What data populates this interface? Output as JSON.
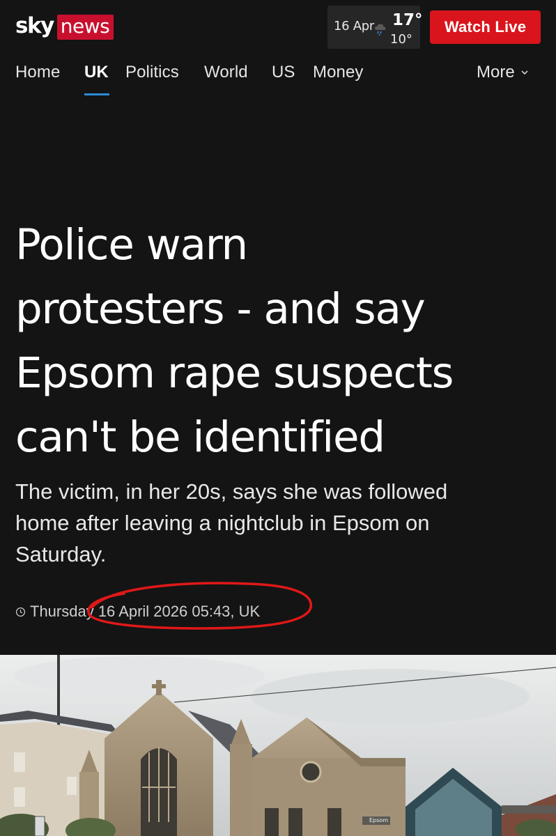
{
  "header": {
    "logo_sky": "sky",
    "logo_news": "news",
    "weather": {
      "date": "16 Apr",
      "high": "17°",
      "low": "10°",
      "icon": "cloud-rain-icon"
    },
    "watch_live": "Watch Live"
  },
  "nav": {
    "items": [
      "Home",
      "UK",
      "Politics",
      "World",
      "US",
      "Money"
    ],
    "active": "UK",
    "more": "More"
  },
  "article": {
    "headline_lines": [
      "Police warn",
      "protesters - and say",
      "Epsom rape suspects",
      "can't be identified"
    ],
    "standfirst_lines": [
      "The victim, in her 20s, says she was followed",
      "home after leaving a nightclub in Epsom on",
      "Saturday."
    ],
    "dateline": "Thursday 16 April 2026 05:43, UK",
    "image_sign_text": "Epsom"
  },
  "colors": {
    "background": "#141414",
    "brand_red": "#c8102e",
    "watch_live_red": "#d9141c",
    "nav_active_underline": "#2a8bd6",
    "annotation_red": "#e01818"
  }
}
